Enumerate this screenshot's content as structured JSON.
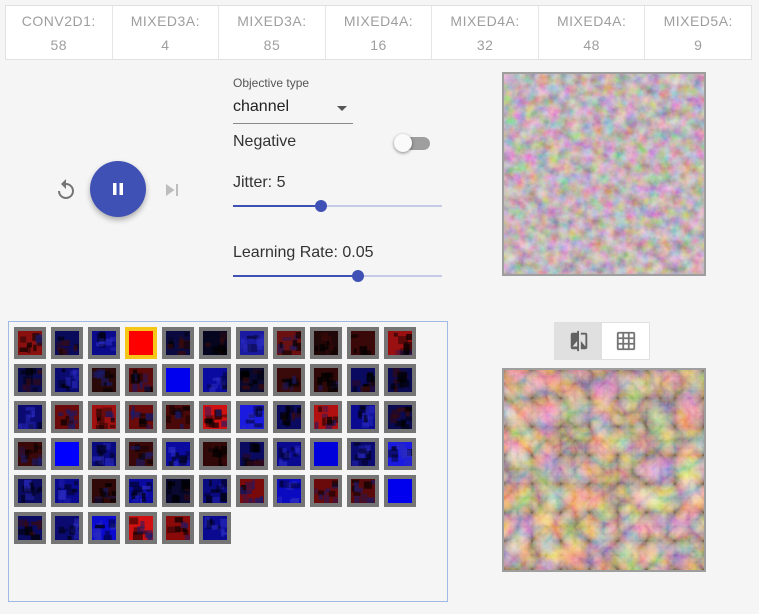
{
  "tabs": [
    {
      "name": "CONV2D1:",
      "value": "58"
    },
    {
      "name": "MIXED3A:",
      "value": "4"
    },
    {
      "name": "MIXED3A:",
      "value": "85"
    },
    {
      "name": "MIXED4A:",
      "value": "16"
    },
    {
      "name": "MIXED4A:",
      "value": "32"
    },
    {
      "name": "MIXED4A:",
      "value": "48"
    },
    {
      "name": "MIXED5A:",
      "value": "9"
    }
  ],
  "playback": {
    "reset_icon": "replay-icon",
    "play_icon": "pause-icon",
    "step_icon": "skip-next-icon"
  },
  "controls": {
    "objective_label": "Objective type",
    "objective_value": "channel",
    "negative_label": "Negative",
    "negative_on": false,
    "jitter_label": "Jitter: 5",
    "jitter_fraction": 0.42,
    "lr_label": "Learning Rate: 0.05",
    "lr_fraction": 0.6
  },
  "view_toggle": {
    "compare_icon": "compare-icon",
    "grid_icon": "grid-icon",
    "active": "compare"
  },
  "colors": {
    "accent": "#3f51b5",
    "selected_border": "#f5c518",
    "cell_border": "#757575"
  },
  "channels": [
    {
      "c": "#8a1010",
      "t": "mixed"
    },
    {
      "c": "#0a0a5a",
      "t": "dark"
    },
    {
      "c": "#0a0a8a",
      "t": "blue"
    },
    {
      "c": "#ff0000",
      "t": "solid"
    },
    {
      "c": "#0a0a40",
      "t": "dark"
    },
    {
      "c": "#050520",
      "t": "dark"
    },
    {
      "c": "#1a1aa0",
      "t": "blue"
    },
    {
      "c": "#6a1010",
      "t": "mixed"
    },
    {
      "c": "#200808",
      "t": "dark"
    },
    {
      "c": "#3a0808",
      "t": "dark"
    },
    {
      "c": "#9a1010",
      "t": "mixed"
    },
    {
      "c": "#0a0a50",
      "t": "dark"
    },
    {
      "c": "#0a0a70",
      "t": "blue"
    },
    {
      "c": "#2a0808",
      "t": "mixed"
    },
    {
      "c": "#5a0a0a",
      "t": "mixed"
    },
    {
      "c": "#0000ee",
      "t": "solid"
    },
    {
      "c": "#0a0aa0",
      "t": "blue"
    },
    {
      "c": "#080830",
      "t": "dark"
    },
    {
      "c": "#3a0a0a",
      "t": "mixed"
    },
    {
      "c": "#300808",
      "t": "mixed"
    },
    {
      "c": "#0a0a60",
      "t": "dark"
    },
    {
      "c": "#0a0a50",
      "t": "dark"
    },
    {
      "c": "#0a0a70",
      "t": "blue"
    },
    {
      "c": "#6a0a0a",
      "t": "mixed"
    },
    {
      "c": "#a01010",
      "t": "mixed"
    },
    {
      "c": "#6a0a0a",
      "t": "mixed"
    },
    {
      "c": "#4a0808",
      "t": "mixed"
    },
    {
      "c": "#d01010",
      "t": "mixed"
    },
    {
      "c": "#1a1ae0",
      "t": "blue"
    },
    {
      "c": "#0a0a60",
      "t": "dark"
    },
    {
      "c": "#b01010",
      "t": "mixed"
    },
    {
      "c": "#0a0a90",
      "t": "blue"
    },
    {
      "c": "#0a0a50",
      "t": "dark"
    },
    {
      "c": "#3a0808",
      "t": "mixed"
    },
    {
      "c": "#0000ff",
      "t": "solid"
    },
    {
      "c": "#0a0a80",
      "t": "blue"
    },
    {
      "c": "#3a0808",
      "t": "mixed"
    },
    {
      "c": "#0a0aa0",
      "t": "blue"
    },
    {
      "c": "#300808",
      "t": "dark"
    },
    {
      "c": "#0a0a60",
      "t": "dark"
    },
    {
      "c": "#0a0a90",
      "t": "blue"
    },
    {
      "c": "#0000dd",
      "t": "solid"
    },
    {
      "c": "#0a0a70",
      "t": "blue"
    },
    {
      "c": "#1a1ae0",
      "t": "blue"
    },
    {
      "c": "#0a0a60",
      "t": "blue"
    },
    {
      "c": "#0a0a90",
      "t": "blue"
    },
    {
      "c": "#300808",
      "t": "mixed"
    },
    {
      "c": "#0a0aa0",
      "t": "blue"
    },
    {
      "c": "#080830",
      "t": "dark"
    },
    {
      "c": "#0a0a80",
      "t": "blue"
    },
    {
      "c": "#7a0a0a",
      "t": "mixed"
    },
    {
      "c": "#0a0ac0",
      "t": "blue"
    },
    {
      "c": "#6a0a0a",
      "t": "mixed"
    },
    {
      "c": "#5a0a0a",
      "t": "mixed"
    },
    {
      "c": "#0000ee",
      "t": "solid"
    },
    {
      "c": "#0a0a60",
      "t": "dark"
    },
    {
      "c": "#0a0a70",
      "t": "blue"
    },
    {
      "c": "#0a0ad0",
      "t": "blue"
    },
    {
      "c": "#d01010",
      "t": "mixed"
    },
    {
      "c": "#8a0a0a",
      "t": "mixed"
    },
    {
      "c": "#0a0a90",
      "t": "blue"
    }
  ],
  "selected_channel": 3
}
